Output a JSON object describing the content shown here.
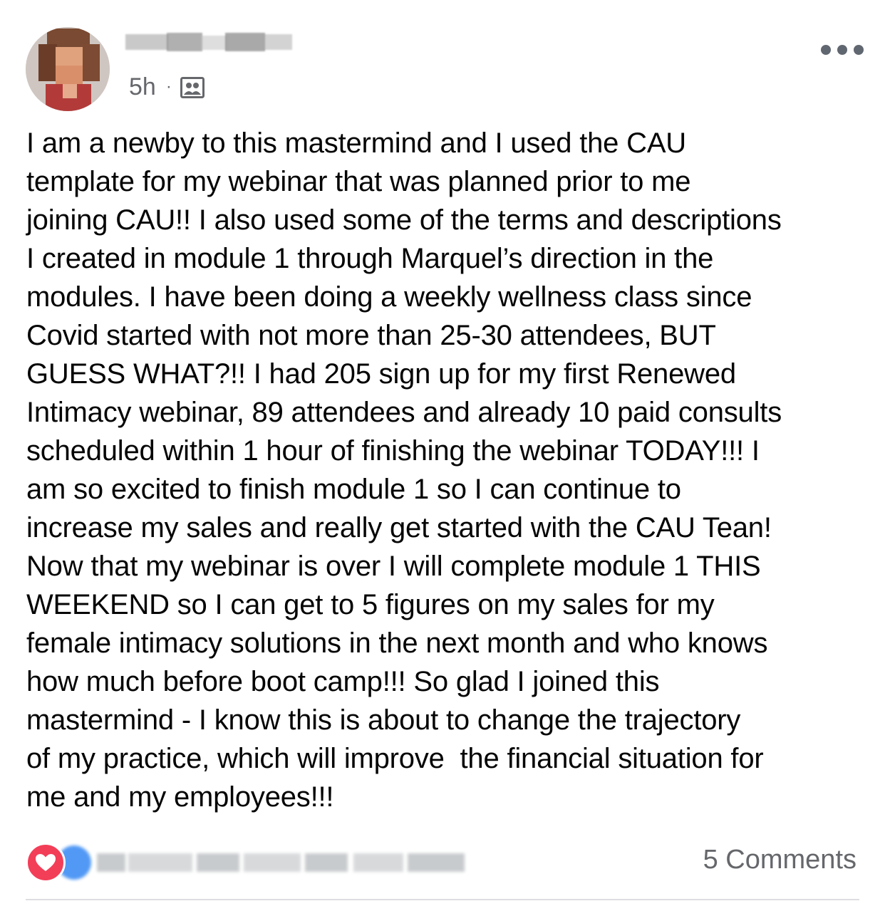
{
  "post": {
    "timestamp": "5h",
    "separator": "·",
    "audience_icon": "group-audience-icon",
    "more_icon": "more-options-icon",
    "text": "I am a newby to this mastermind and I used the CAU\ntemplate for my webinar that was planned prior to me\njoining CAU!! I also used some of the terms and descriptions\nI created in module 1 through Marquel’s direction in the\nmodules. I have been doing a weekly wellness class since\nCovid started with not more than 25-30 attendees, BUT\nGUESS WHAT?!! I had 205 sign up for my first Renewed\nIntimacy webinar, 89 attendees and already 10 paid consults\nscheduled within 1 hour of finishing the webinar TODAY!!! I\nam so excited to finish module 1 so I can continue to\nincrease my sales and really get started with the CAU Tean!\nNow that my webinar is over I will complete module 1 THIS\nWEEKEND so I can get to 5 figures on my sales for my\nfemale intimacy solutions in the next month and who knows\nhow much before boot camp!!! So glad I joined this\nmastermind - I know this is about to change the trajectory\nof my practice, which will improve  the financial situation for\nme and my employees!!!"
  },
  "footer": {
    "reaction_icons": [
      "love-reaction-icon",
      "like-reaction-icon"
    ],
    "comments_label": "5 Comments"
  },
  "colors": {
    "text": "#050505",
    "secondary_text": "#65676b",
    "love": "#f33e58",
    "like": "#1877f2",
    "divider": "#ced0d4"
  }
}
